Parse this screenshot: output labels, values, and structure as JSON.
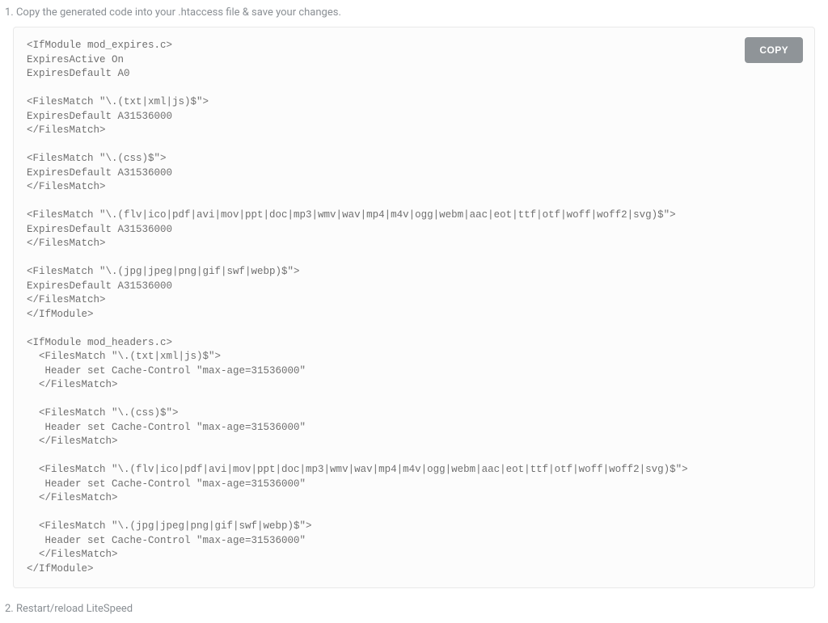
{
  "step1": {
    "label": "1. Copy the generated code into your .htaccess file & save your changes."
  },
  "copy": {
    "label": "COPY"
  },
  "code": {
    "text": "<IfModule mod_expires.c>\nExpiresActive On\nExpiresDefault A0\n\n<FilesMatch \"\\.(txt|xml|js)$\">\nExpiresDefault A31536000\n</FilesMatch>\n\n<FilesMatch \"\\.(css)$\">\nExpiresDefault A31536000\n</FilesMatch>\n\n<FilesMatch \"\\.(flv|ico|pdf|avi|mov|ppt|doc|mp3|wmv|wav|mp4|m4v|ogg|webm|aac|eot|ttf|otf|woff|woff2|svg)$\">\nExpiresDefault A31536000\n</FilesMatch>\n\n<FilesMatch \"\\.(jpg|jpeg|png|gif|swf|webp)$\">\nExpiresDefault A31536000\n</FilesMatch>\n</IfModule>\n\n<IfModule mod_headers.c>\n  <FilesMatch \"\\.(txt|xml|js)$\">\n   Header set Cache-Control \"max-age=31536000\"\n  </FilesMatch>\n\n  <FilesMatch \"\\.(css)$\">\n   Header set Cache-Control \"max-age=31536000\"\n  </FilesMatch>\n\n  <FilesMatch \"\\.(flv|ico|pdf|avi|mov|ppt|doc|mp3|wmv|wav|mp4|m4v|ogg|webm|aac|eot|ttf|otf|woff|woff2|svg)$\">\n   Header set Cache-Control \"max-age=31536000\"\n  </FilesMatch>\n\n  <FilesMatch \"\\.(jpg|jpeg|png|gif|swf|webp)$\">\n   Header set Cache-Control \"max-age=31536000\"\n  </FilesMatch>\n</IfModule>"
  },
  "step2": {
    "label": "2. Restart/reload LiteSpeed"
  }
}
